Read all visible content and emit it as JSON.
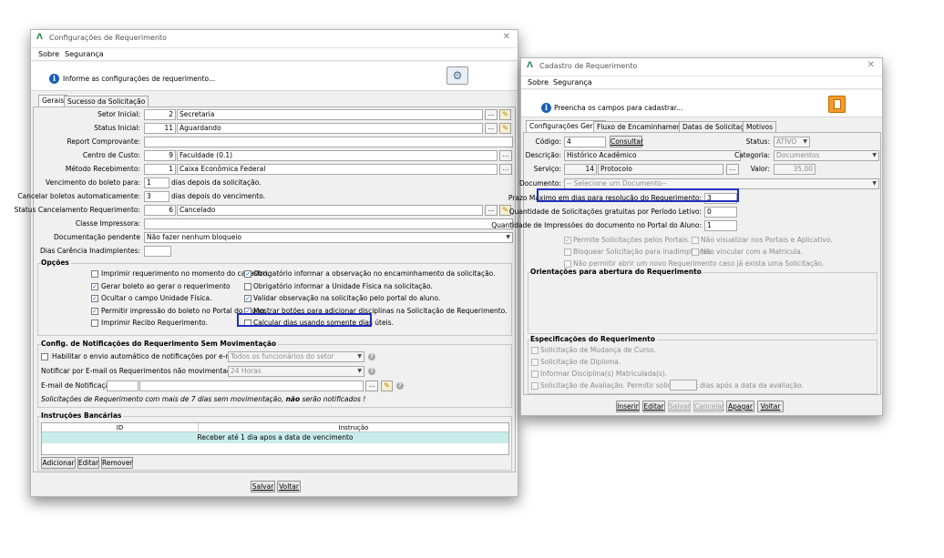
{
  "left": {
    "title": "Configurações de Requerimento",
    "menu": [
      "Sobre",
      "Segurança"
    ],
    "info": "Informe as configurações de requerimento...",
    "tabs": [
      "Gerais",
      "Sucesso da Solicitação"
    ],
    "fields": {
      "setor": {
        "label": "Setor Inicial:",
        "code": "2",
        "name": "Secretaria"
      },
      "status": {
        "label": "Status Inicial:",
        "code": "11",
        "name": "Aguardando"
      },
      "report": {
        "label": "Report Comprovante:"
      },
      "centro": {
        "label": "Centro de Custo:",
        "code": "9",
        "name": "Faculdade (0.1)"
      },
      "metodo": {
        "label": "Método Recebimento:",
        "code": "1",
        "name": "Caixa Econômica Federal"
      },
      "venc": {
        "label": "Vencimento do boleto para:",
        "value": "1",
        "suffix": "dias depois da solicitação."
      },
      "cancelar": {
        "label": "Cancelar boletos automaticamente:",
        "value": "3",
        "suffix": "dias depois do vencimento."
      },
      "statusCanc": {
        "label": "Status Cancelamento Requerimento:",
        "code": "6",
        "name": "Cancelado"
      },
      "impressora": {
        "label": "Classe Impressora:"
      },
      "docpend": {
        "label": "Documentação pendente",
        "value": "Não fazer nenhum bloqueio"
      },
      "carencia": {
        "label": "Dias Carência Inadimplentes:"
      }
    },
    "opcoes": {
      "title": "Opções",
      "left": [
        {
          "label": "Imprimir requerimento no momento do cadastro.",
          "checked": false
        },
        {
          "label": "Gerar boleto ao gerar o requerimento",
          "checked": true
        },
        {
          "label": "Ocultar o campo Unidade Física.",
          "checked": true
        },
        {
          "label": "Permitir impressão do boleto no Portal do Aluno.",
          "checked": true
        },
        {
          "label": "Imprimir Recibo Requerimento.",
          "checked": false
        }
      ],
      "right": [
        {
          "label": "Obrigatório informar a observação no encaminhamento da solicitação.",
          "checked": true
        },
        {
          "label": "Obrigatório informar a Unidade Física na solicitação.",
          "checked": false
        },
        {
          "label": "Validar observação na solicitação pelo portal do aluno.",
          "checked": true
        },
        {
          "label": "Mostrar botões para adicionar disciplinas na Solicitação de Requerimento.",
          "checked": true
        },
        {
          "label": "Calcular dias usando somente dias úteis.",
          "checked": false
        }
      ]
    },
    "notif": {
      "title": "Config. de Notificações do Requerimento Sem Movimentação",
      "habilitar": "Habilitar o envio automático de notificações por e-mail para:",
      "habilitarValue": "Todos os funcionários do setor",
      "notificar": "Notificar por E-mail os Requerimentos não movimentados após:",
      "notificarValue": "24 Horas",
      "email": "E-mail de Notificação:",
      "note_pre": "Solicitações de Requerimento com mais de 7 dias sem movimentação, ",
      "note_bold": "não",
      "note_post": " serão notificados !"
    },
    "instr": {
      "title": "Instruções Bancárias",
      "cols": [
        "ID",
        "Instrução"
      ],
      "rows": [
        {
          "id": "",
          "text": "Receber até 1 dia apos a data de vencimento"
        }
      ],
      "buttons": [
        "Adicionar",
        "Editar",
        "Remover"
      ]
    },
    "footer": [
      "Salvar",
      "Voltar"
    ]
  },
  "right": {
    "title": "Cadastro de Requerimento",
    "menu": [
      "Sobre",
      "Segurança"
    ],
    "info": "Preencha os campos para cadastrar...",
    "tabs": [
      "Configurações Gerais",
      "Fluxo de Encaminhamentos",
      "Datas de Solicitação",
      "Motivos"
    ],
    "codigo": {
      "label": "Código:",
      "value": "4",
      "button": "Consultar"
    },
    "status": {
      "label": "Status:",
      "value": "ATIVO"
    },
    "descricao": {
      "label": "Descrição:",
      "value": "Histórico Acadêmico"
    },
    "categoria": {
      "label": "Categoria:",
      "value": "Documentos"
    },
    "servico": {
      "label": "Serviço:",
      "code": "14",
      "name": "Protocolo"
    },
    "valor": {
      "label": "Valor:",
      "value": "35,00"
    },
    "documento": {
      "label": "Documento:",
      "value": "-- Selecione um Documento--"
    },
    "prazo": {
      "label": "Prazo Máximo em dias para resolução do Requerimento:",
      "value": "3"
    },
    "gratuitas": {
      "label": "Quantidade de Solicitações gratuitas por Período Letivo:",
      "value": "0"
    },
    "impressoes": {
      "label": "Quantidade de Impressões do documento no Portal do Aluno:",
      "value": "1"
    },
    "checks": [
      {
        "label": "Permite Solicitações pelos Portais.",
        "checked": true
      },
      {
        "label": "Não visualizar nos Portais e Aplicativo.",
        "checked": false
      },
      {
        "label": "Bloquear Solicitação para inadimplentes.",
        "checked": false
      },
      {
        "label": "Não vincular com a Matricula.",
        "checked": false
      },
      {
        "label": "Não permitir abrir um novo Requerimento caso já exista uma Solicitação.",
        "checked": false
      }
    ],
    "orientacoes": "Orientações para abertura do Requerimento",
    "especificacoes": {
      "title": "Especificações do Requerimento",
      "items": [
        "Solicitação de Mudança de Curso.",
        "Solicitação de Diploma.",
        "Informar Disciplina(s) Matriculada(s)."
      ],
      "aval_pre": "Solicitação de Avaliação. Permitir solicitar até:",
      "aval_post": "dias após a data da avaliação."
    },
    "footer": [
      "Inserir",
      "Editar",
      "Salvar",
      "Cancelar",
      "Apagar",
      "Voltar"
    ]
  }
}
